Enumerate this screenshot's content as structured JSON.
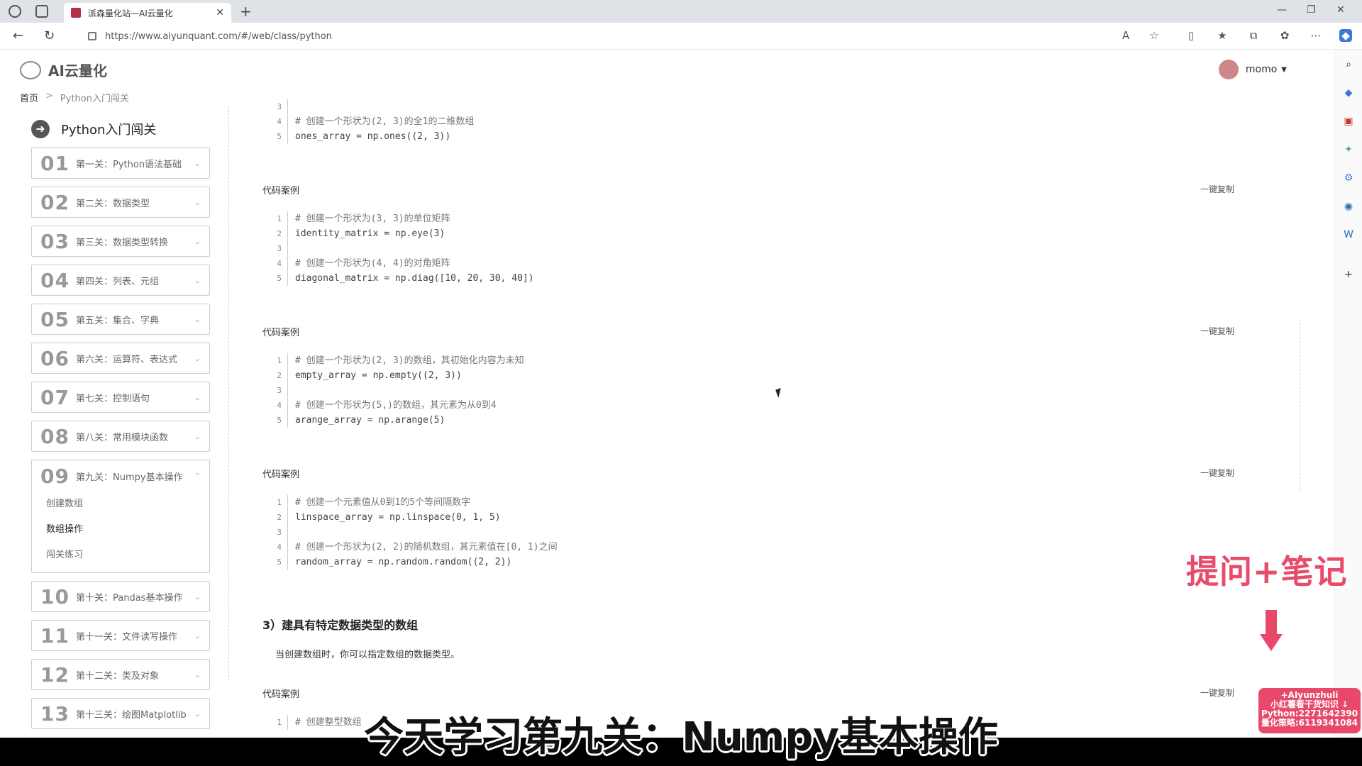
{
  "browser": {
    "tab_title": "派森量化站—AI云量化",
    "url": "https://www.aiyunquant.com/#/web/class/python"
  },
  "header": {
    "logo_text": "AI云量化",
    "username": "momo"
  },
  "breadcrumb": {
    "home": "首页",
    "current": "Python入门闯关"
  },
  "sidebar": {
    "title": "Python入门闯关",
    "levels": [
      {
        "num": "01",
        "name": "第一关：Python语法基础"
      },
      {
        "num": "02",
        "name": "第二关：数据类型"
      },
      {
        "num": "03",
        "name": "第三关：数据类型转换"
      },
      {
        "num": "04",
        "name": "第四关：列表、元组"
      },
      {
        "num": "05",
        "name": "第五关：集合、字典"
      },
      {
        "num": "06",
        "name": "第六关：运算符、表达式"
      },
      {
        "num": "07",
        "name": "第七关：控制语句"
      },
      {
        "num": "08",
        "name": "第八关：常用模块函数"
      },
      {
        "num": "09",
        "name": "第九关：Numpy基本操作",
        "sub": [
          "创建数组",
          "数组操作",
          "闯关练习"
        ]
      },
      {
        "num": "10",
        "name": "第十关：Pandas基本操作"
      },
      {
        "num": "11",
        "name": "第十一关：文件读写操作"
      },
      {
        "num": "12",
        "name": "第十二关：类及对象"
      },
      {
        "num": "13",
        "name": "第十三关：绘图Matplotlib"
      }
    ]
  },
  "content": {
    "case_label": "代码案例",
    "copy_label": "一键复制",
    "block0": {
      "lines": [
        {
          "n": "3",
          "t": ""
        },
        {
          "n": "4",
          "t": "# 创建一个形状为(2, 3)的全1的二维数组"
        },
        {
          "n": "5",
          "t": "ones_array = np.ones((2, 3))"
        }
      ]
    },
    "block1": {
      "lines": [
        {
          "n": "1",
          "t": "# 创建一个形状为(3, 3)的单位矩阵"
        },
        {
          "n": "2",
          "t": "identity_matrix = np.eye(3)"
        },
        {
          "n": "3",
          "t": ""
        },
        {
          "n": "4",
          "t": "# 创建一个形状为(4, 4)的对角矩阵"
        },
        {
          "n": "5",
          "t": "diagonal_matrix = np.diag([10, 20, 30, 40])"
        }
      ]
    },
    "block2": {
      "lines": [
        {
          "n": "1",
          "t": "# 创建一个形状为(2, 3)的数组，其初始化内容为未知"
        },
        {
          "n": "2",
          "t": "empty_array = np.empty((2, 3))"
        },
        {
          "n": "3",
          "t": ""
        },
        {
          "n": "4",
          "t": "# 创建一个形状为(5,)的数组，其元素为从0到4"
        },
        {
          "n": "5",
          "t": "arange_array = np.arange(5)"
        }
      ]
    },
    "block3": {
      "lines": [
        {
          "n": "1",
          "t": "# 创建一个元素值从0到1的5个等间隔数字"
        },
        {
          "n": "2",
          "t": "linspace_array = np.linspace(0, 1, 5)"
        },
        {
          "n": "3",
          "t": ""
        },
        {
          "n": "4",
          "t": "# 创建一个形状为(2, 2)的随机数组，其元素值在[0, 1)之间"
        },
        {
          "n": "5",
          "t": "random_array = np.random.random((2, 2))"
        }
      ]
    },
    "section_heading": "3）建具有特定数据类型的数组",
    "section_desc": "当创建数组时，你可以指定数组的数据类型。",
    "block4": {
      "lines": [
        {
          "n": "1",
          "t": "# 创建整型数组"
        }
      ]
    }
  },
  "overlay": {
    "note_text": "提问+笔记",
    "promo_lines": [
      "+AIyunzhuli",
      "小红薯看干货知识 ↓",
      "Python:2271642390",
      "量化策略:6119341084"
    ],
    "subtitle": "今天学习第九关：Numpy基本操作"
  }
}
